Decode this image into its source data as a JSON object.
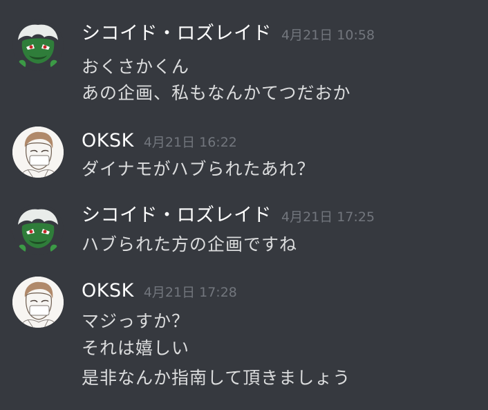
{
  "colors": {
    "background": "#36393f",
    "username": "#ffffff",
    "timestamp": "#72767d",
    "message_text": "#dcddde"
  },
  "messages": [
    {
      "author": "シコイド・ロズレイド",
      "avatar": "green-creature-avatar",
      "timestamp": "4月21日 10:58",
      "lines": [
        "おくさかくん",
        "あの企画、私もなんかてつだおか"
      ]
    },
    {
      "author": "OKSK",
      "avatar": "masked-man-avatar",
      "timestamp": "4月21日 16:22",
      "lines": [
        "ダイナモがハブられたあれ？"
      ]
    },
    {
      "author": "シコイド・ロズレイド",
      "avatar": "green-creature-avatar",
      "timestamp": "4月21日 17:25",
      "lines": [
        "ハブられた方の企画ですね"
      ]
    },
    {
      "author": "OKSK",
      "avatar": "masked-man-avatar",
      "timestamp": "4月21日 17:28",
      "lines": [
        "マジっすか？",
        "それは嬉しい",
        "是非なんか指南して頂きましょう"
      ]
    }
  ]
}
